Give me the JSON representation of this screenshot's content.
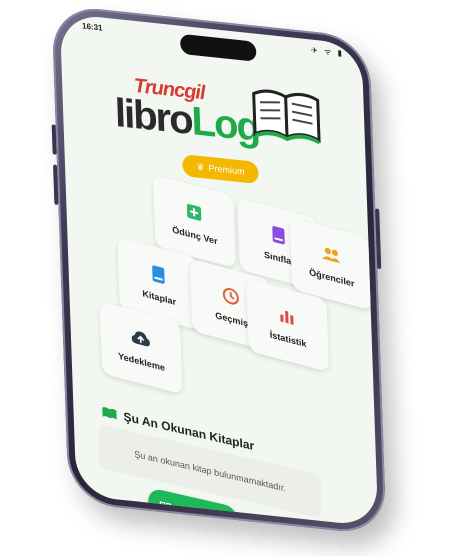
{
  "status_bar": {
    "time": "16:31",
    "icons": "✈ ᯤ ▮"
  },
  "logo": {
    "top_word": "Truncgil",
    "main_word_a": "libro",
    "main_word_b": "Log"
  },
  "premium": {
    "label": "Premium"
  },
  "menu": [
    {
      "id": "odunc-ver",
      "label": "Ödünç Ver",
      "icon": "plus-square-icon",
      "color": "#2fb867"
    },
    {
      "id": "siniflar",
      "label": "Sınıflar",
      "icon": "book-icon",
      "color": "#8a4de0"
    },
    {
      "id": "ogrenciler",
      "label": "Öğrenciler",
      "icon": "users-icon",
      "color": "#f0a020"
    },
    {
      "id": "kitaplar",
      "label": "Kitaplar",
      "icon": "book-icon",
      "color": "#2a8ee0"
    },
    {
      "id": "gecmis",
      "label": "Geçmiş",
      "icon": "history-icon",
      "color": "#e0603a"
    },
    {
      "id": "istatistik",
      "label": "İstatistik",
      "icon": "bar-chart-icon",
      "color": "#e04848"
    },
    {
      "id": "yedekleme",
      "label": "Yedekleme",
      "icon": "cloud-upload-icon",
      "color": "#2a3a4a"
    }
  ],
  "reading": {
    "title": "Şu An Okunan Kitaplar",
    "empty_text": "Şu an okunan kitap bulunmamaktadır."
  },
  "barcode": {
    "label": "Barkod Okut"
  }
}
